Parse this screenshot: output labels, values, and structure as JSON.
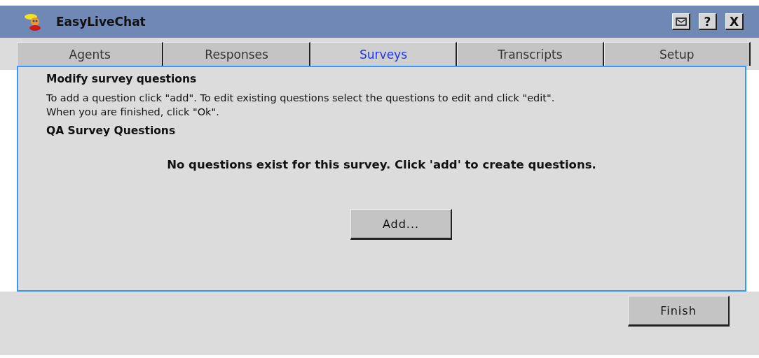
{
  "window": {
    "title": "EasyLiveChat",
    "buttons": [
      "?",
      "X"
    ]
  },
  "tabs": [
    {
      "label": "Agents",
      "selected": false
    },
    {
      "label": "Responses",
      "selected": false
    },
    {
      "label": "Surveys",
      "selected": true
    },
    {
      "label": "Transcripts",
      "selected": false
    },
    {
      "label": "Setup",
      "selected": false
    }
  ],
  "panel": {
    "heading": "Modify survey questions",
    "instructions": [
      "To add a question click \"add\". To edit existing questions select the questions to edit and click \"edit\".",
      "When you are finished, click \"Ok\"."
    ],
    "subheading": "QA Survey Questions",
    "empty_message": "No questions exist for this survey. Click 'add' to create questions.",
    "add_button": "Add..."
  },
  "finish_button": "Finish"
}
